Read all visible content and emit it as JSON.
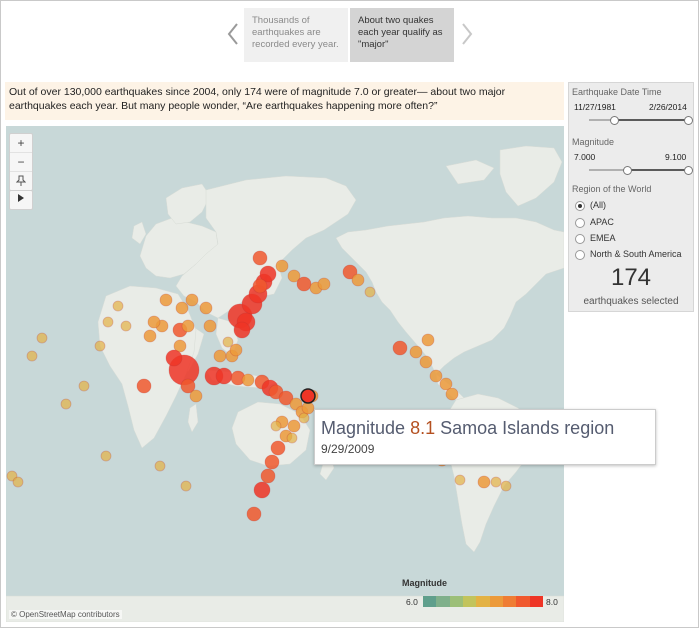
{
  "story": {
    "points": [
      "Thousands of earthquakes are recorded every year.",
      "About two quakes each year qualify as \"major\""
    ],
    "active_index": 1
  },
  "caption": "Out of over 130,000 earthquakes since 2004, only 174 were of magnitude 7.0 or greater— about two major earthquakes each year. But many people wonder, “Are earthquakes happening more often?”",
  "map": {
    "zoom_in": "+",
    "zoom_out": "−",
    "attribution": "© OpenStreetMap contributors",
    "legend": {
      "title": "Magnitude",
      "min": "6.0",
      "max": "8.0",
      "colors": [
        "#5f9f8c",
        "#7fb08b",
        "#9cbf78",
        "#c2c45c",
        "#e3b244",
        "#ec9a3a",
        "#ef7d34",
        "#f0592e",
        "#ee3526"
      ]
    }
  },
  "tooltip": {
    "prefix": "Magnitude",
    "magnitude": "8.1",
    "region": "Samoa Islands region",
    "date": "9/29/2009"
  },
  "filters": {
    "date": {
      "title": "Earthquake Date Time",
      "min": "11/27/1981",
      "max": "2/26/2014",
      "range": [
        0.25,
        1.0
      ]
    },
    "magnitude": {
      "title": "Magnitude",
      "min": "7.000",
      "max": "9.100",
      "range": [
        0.38,
        1.0
      ]
    },
    "region": {
      "title": "Region of the World",
      "options": [
        "(All)",
        "APAC",
        "EMEA",
        "North & South America"
      ],
      "selected": 0
    }
  },
  "count": {
    "value": "174",
    "label": "earthquakes selected"
  }
}
